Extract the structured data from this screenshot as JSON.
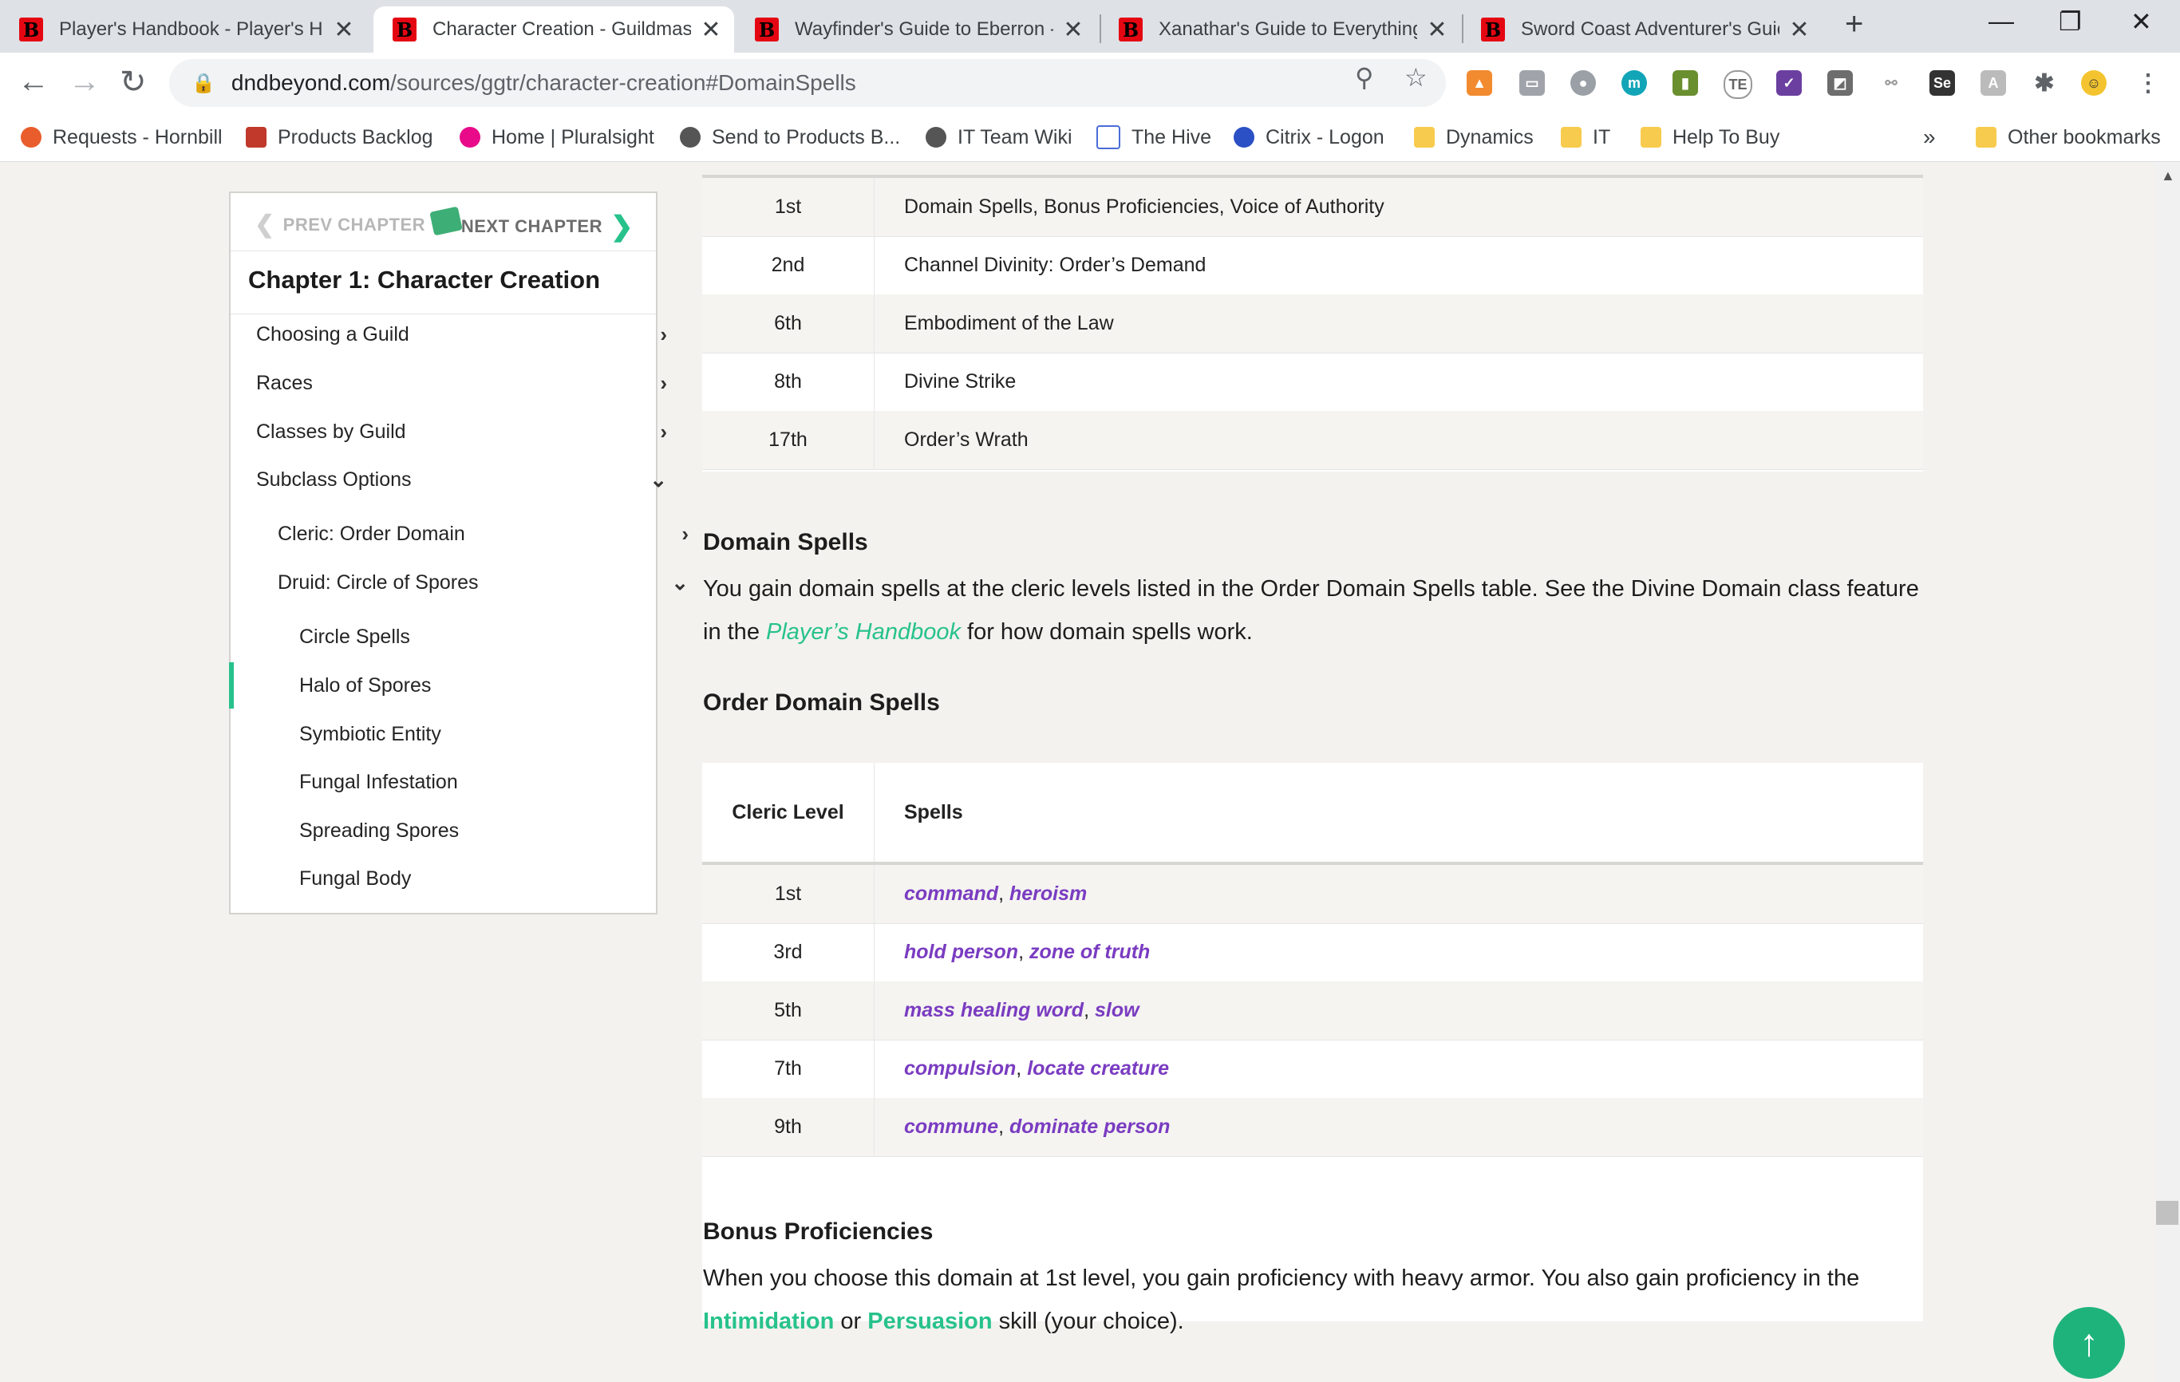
{
  "tabs": [
    {
      "title": "Player's Handbook - Player's H"
    },
    {
      "title": "Character Creation - Guildmast"
    },
    {
      "title": "Wayfinder's Guide to Eberron -"
    },
    {
      "title": "Xanathar's Guide to Everything"
    },
    {
      "title": "Sword Coast Adventurer's Guic"
    }
  ],
  "favicon_letter": "B",
  "url": {
    "host": "dndbeyond.com",
    "path": "/sources/ggtr/character-creation#DomainSpells"
  },
  "bookmarks": [
    {
      "label": "Requests - Hornbill"
    },
    {
      "label": "Products Backlog"
    },
    {
      "label": "Home | Pluralsight"
    },
    {
      "label": "Send to Products B..."
    },
    {
      "label": "IT Team Wiki"
    },
    {
      "label": "The Hive"
    },
    {
      "label": "Citrix - Logon"
    },
    {
      "label": "Dynamics"
    },
    {
      "label": "IT"
    },
    {
      "label": "Help To Buy"
    }
  ],
  "bookmarks_overflow": "»",
  "other_bookmarks": "Other bookmarks",
  "toc": {
    "prev": "PREV CHAPTER",
    "next": "NEXT CHAPTER",
    "title": "Chapter 1: Character Creation",
    "items": [
      {
        "label": "Choosing a Guild"
      },
      {
        "label": "Races"
      },
      {
        "label": "Classes by Guild"
      },
      {
        "label": "Subclass Options"
      },
      {
        "label": "Cleric: Order Domain"
      },
      {
        "label": "Druid: Circle of Spores"
      },
      {
        "label": "Circle Spells"
      },
      {
        "label": "Halo of Spores"
      },
      {
        "label": "Symbiotic Entity"
      },
      {
        "label": "Fungal Infestation"
      },
      {
        "label": "Spreading Spores"
      },
      {
        "label": "Fungal Body"
      }
    ]
  },
  "features_table": {
    "rows": [
      {
        "level": "1st",
        "feature": "Domain Spells, Bonus Proficiencies, Voice of Authority"
      },
      {
        "level": "2nd",
        "feature": "Channel Divinity: Order’s Demand"
      },
      {
        "level": "6th",
        "feature": "Embodiment of the Law"
      },
      {
        "level": "8th",
        "feature": "Divine Strike"
      },
      {
        "level": "17th",
        "feature": "Order’s Wrath"
      }
    ]
  },
  "domain_spells": {
    "heading": "Domain Spells",
    "text_a": "You gain domain spells at the cleric levels listed in the Order Domain Spells table. See the Divine Domain class feature in the ",
    "link": "Player’s Handbook",
    "text_b": " for how domain spells work."
  },
  "spells_table": {
    "heading": "Order Domain Spells",
    "col1": "Cleric Level",
    "col2": "Spells",
    "rows": [
      {
        "level": "1st",
        "a": "command",
        "b": "heroism"
      },
      {
        "level": "3rd",
        "a": "hold person",
        "b": "zone of truth"
      },
      {
        "level": "5th",
        "a": "mass healing word",
        "b": "slow"
      },
      {
        "level": "7th",
        "a": "compulsion",
        "b": "locate creature"
      },
      {
        "level": "9th",
        "a": "commune",
        "b": "dominate person"
      }
    ],
    "sep": ", "
  },
  "bonus": {
    "heading": "Bonus Proficiencies",
    "text_a": "When you choose this domain at 1st level, you gain proficiency with heavy armor. You also gain proficiency in the ",
    "skill1": "Intimidation",
    "or": " or ",
    "skill2": "Persuasion",
    "text_b": " skill (your choice)."
  },
  "colors": {
    "accent": "#27c28b",
    "spell": "#7a3cc1",
    "brand": "#e40712"
  }
}
